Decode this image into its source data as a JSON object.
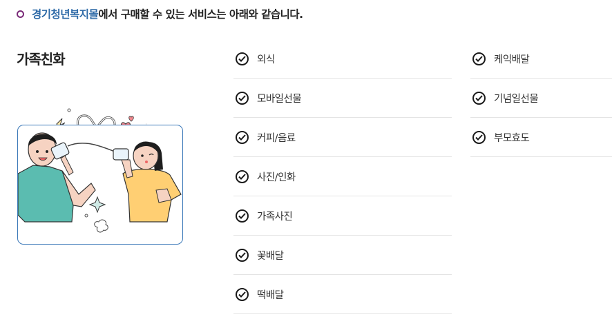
{
  "header": {
    "brand": "경기청년복지몰",
    "rest": "에서 구매할 수 있는 서비스는 아래와 같습니다."
  },
  "section": {
    "title": "가족친화"
  },
  "services_col1": [
    {
      "label": "외식"
    },
    {
      "label": "모바일선물"
    },
    {
      "label": "커피/음료"
    },
    {
      "label": "사진/인화"
    },
    {
      "label": "가족사진"
    },
    {
      "label": "꽃배달"
    },
    {
      "label": "떡배달"
    }
  ],
  "services_col2": [
    {
      "label": "케익배달"
    },
    {
      "label": "기념일선물"
    },
    {
      "label": "부모효도"
    }
  ],
  "colors": {
    "brand": "#2f6ba8",
    "bullet": "#7a2b78",
    "frame": "#3a78b8",
    "teal": "#5bbcb0",
    "yellow": "#ffcf73",
    "heart": "#f3898f"
  }
}
